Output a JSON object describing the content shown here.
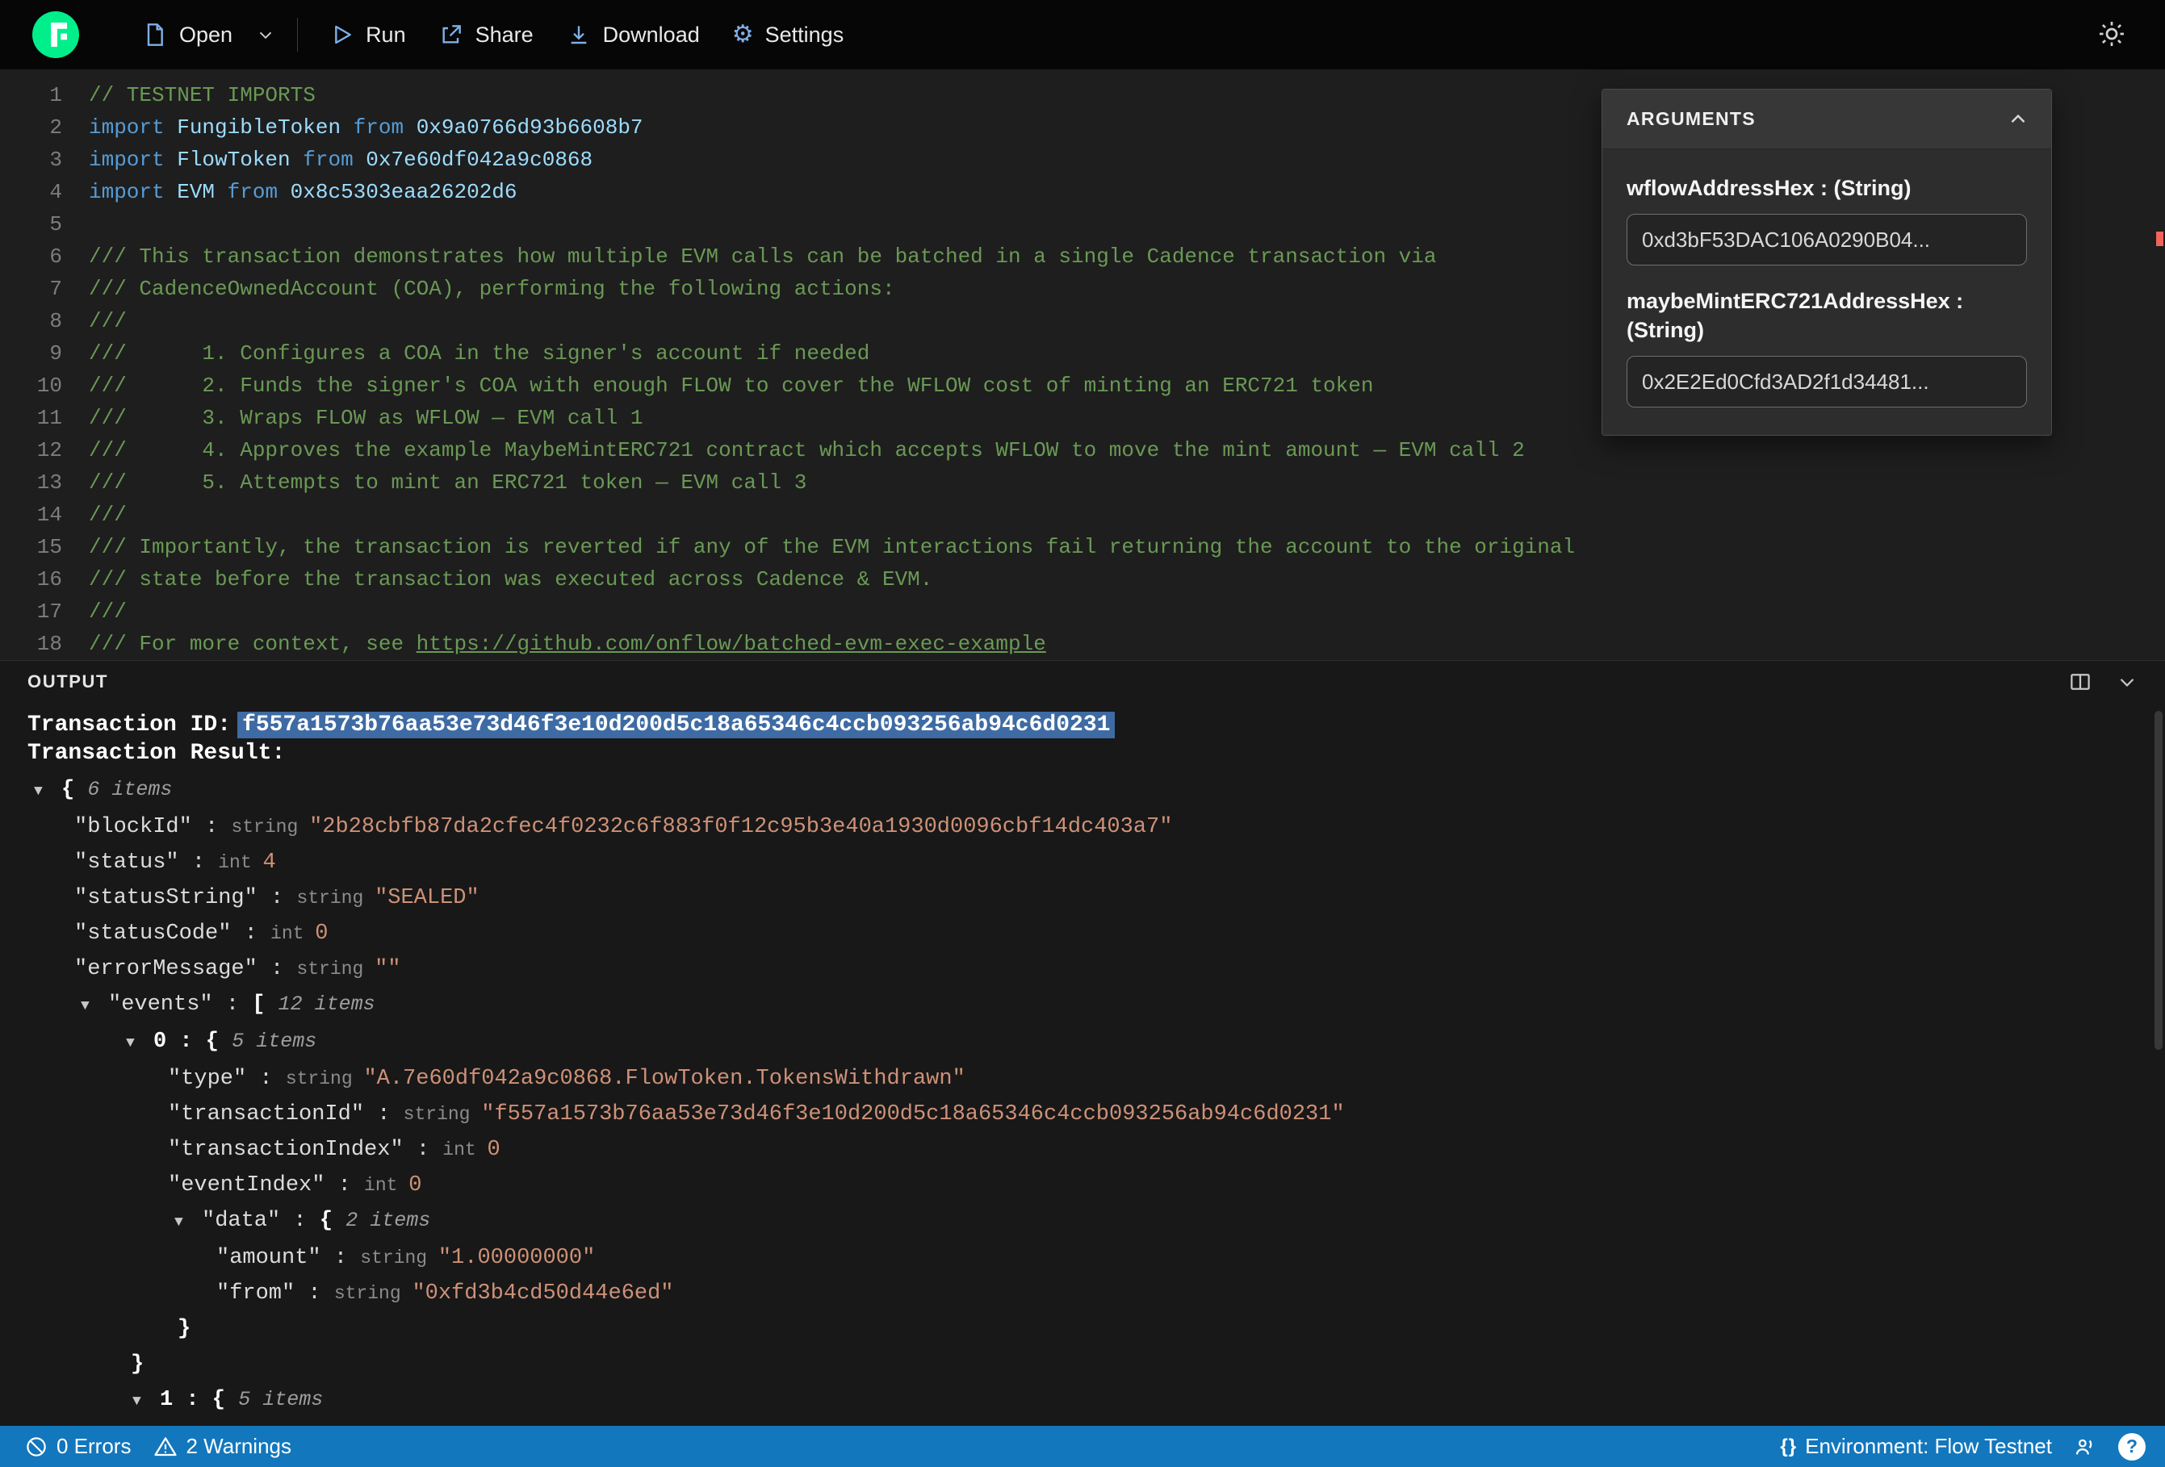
{
  "toolbar": {
    "open_label": "Open",
    "run_label": "Run",
    "share_label": "Share",
    "download_label": "Download",
    "settings_label": "Settings"
  },
  "editor": {
    "lines": [
      {
        "n": "1",
        "segs": [
          {
            "c": "comment",
            "t": "// TESTNET IMPORTS"
          }
        ]
      },
      {
        "n": "2",
        "segs": [
          {
            "c": "kw",
            "t": "import "
          },
          {
            "c": "ident",
            "t": "FungibleToken"
          },
          {
            "c": "kw",
            "t": " from "
          },
          {
            "c": "ident",
            "t": "0x9a0766d93b6608b7"
          }
        ]
      },
      {
        "n": "3",
        "segs": [
          {
            "c": "kw",
            "t": "import "
          },
          {
            "c": "ident",
            "t": "FlowToken"
          },
          {
            "c": "kw",
            "t": " from "
          },
          {
            "c": "ident",
            "t": "0x7e60df042a9c0868"
          }
        ]
      },
      {
        "n": "4",
        "segs": [
          {
            "c": "kw",
            "t": "import "
          },
          {
            "c": "ident",
            "t": "EVM"
          },
          {
            "c": "kw",
            "t": " from "
          },
          {
            "c": "ident",
            "t": "0x8c5303eaa26202d6"
          }
        ]
      },
      {
        "n": "5",
        "segs": []
      },
      {
        "n": "6",
        "segs": [
          {
            "c": "comment",
            "t": "/// This transaction demonstrates how multiple EVM calls can be batched in a single Cadence transaction via"
          }
        ]
      },
      {
        "n": "7",
        "segs": [
          {
            "c": "comment",
            "t": "/// CadenceOwnedAccount (COA), performing the following actions:"
          }
        ]
      },
      {
        "n": "8",
        "segs": [
          {
            "c": "comment",
            "t": "///"
          }
        ]
      },
      {
        "n": "9",
        "segs": [
          {
            "c": "comment",
            "t": "///      1. Configures a COA in the signer's account if needed"
          }
        ]
      },
      {
        "n": "10",
        "segs": [
          {
            "c": "comment",
            "t": "///      2. Funds the signer's COA with enough FLOW to cover the WFLOW cost of minting an ERC721 token"
          }
        ]
      },
      {
        "n": "11",
        "segs": [
          {
            "c": "comment",
            "t": "///      3. Wraps FLOW as WFLOW — EVM call 1"
          }
        ]
      },
      {
        "n": "12",
        "segs": [
          {
            "c": "comment",
            "t": "///      4. Approves the example MaybeMintERC721 contract which accepts WFLOW to move the mint amount — EVM call 2"
          }
        ]
      },
      {
        "n": "13",
        "segs": [
          {
            "c": "comment",
            "t": "///      5. Attempts to mint an ERC721 token — EVM call 3"
          }
        ]
      },
      {
        "n": "14",
        "segs": [
          {
            "c": "comment",
            "t": "///"
          }
        ]
      },
      {
        "n": "15",
        "segs": [
          {
            "c": "comment",
            "t": "/// Importantly, the transaction is reverted if any of the EVM interactions fail returning the account to the original"
          }
        ]
      },
      {
        "n": "16",
        "segs": [
          {
            "c": "comment",
            "t": "/// state before the transaction was executed across Cadence & EVM."
          }
        ]
      },
      {
        "n": "17",
        "segs": [
          {
            "c": "comment",
            "t": "///"
          }
        ]
      },
      {
        "n": "18",
        "segs": [
          {
            "c": "comment",
            "t": "/// For more context, see "
          },
          {
            "c": "link",
            "t": "https://github.com/onflow/batched-evm-exec-example"
          }
        ]
      }
    ]
  },
  "arguments_panel": {
    "title": "ARGUMENTS",
    "fields": [
      {
        "label": "wflowAddressHex : (String)",
        "value": "0xd3bF53DAC106A0290B04..."
      },
      {
        "label": "maybeMintERC721AddressHex : (String)",
        "value": "0x2E2Ed0Cfd3AD2f1d34481..."
      }
    ]
  },
  "output": {
    "title": "OUTPUT",
    "transaction_id_label": "Transaction ID:",
    "transaction_id": "f557a1573b76aa53e73d46f3e10d200d5c18a65346c4ccb093256ab94c6d0231",
    "transaction_result_label": "Transaction Result:",
    "arrow_glyph": "▼",
    "tree": [
      {
        "indent": 8,
        "arrow": true,
        "segs": [
          {
            "c": "brace",
            "t": "{ "
          },
          {
            "c": "items",
            "t": "6 items"
          }
        ]
      },
      {
        "indent": 58,
        "arrow": false,
        "segs": [
          {
            "c": "key",
            "t": "\"blockId\""
          },
          {
            "c": "punct",
            "t": " : "
          },
          {
            "c": "type",
            "t": "string "
          },
          {
            "c": "str",
            "t": "\"2b28cbfb87da2cfec4f0232c6f883f0f12c95b3e40a1930d0096cbf14dc403a7\""
          }
        ]
      },
      {
        "indent": 58,
        "arrow": false,
        "segs": [
          {
            "c": "key",
            "t": "\"status\""
          },
          {
            "c": "punct",
            "t": " : "
          },
          {
            "c": "type",
            "t": "int "
          },
          {
            "c": "num",
            "t": "4"
          }
        ]
      },
      {
        "indent": 58,
        "arrow": false,
        "segs": [
          {
            "c": "key",
            "t": "\"statusString\""
          },
          {
            "c": "punct",
            "t": " : "
          },
          {
            "c": "type",
            "t": "string "
          },
          {
            "c": "str",
            "t": "\"SEALED\""
          }
        ]
      },
      {
        "indent": 58,
        "arrow": false,
        "segs": [
          {
            "c": "key",
            "t": "\"statusCode\""
          },
          {
            "c": "punct",
            "t": " : "
          },
          {
            "c": "type",
            "t": "int "
          },
          {
            "c": "num",
            "t": "0"
          }
        ]
      },
      {
        "indent": 58,
        "arrow": false,
        "segs": [
          {
            "c": "key",
            "t": "\"errorMessage\""
          },
          {
            "c": "punct",
            "t": " : "
          },
          {
            "c": "type",
            "t": "string "
          },
          {
            "c": "str",
            "t": "\"\""
          }
        ]
      },
      {
        "indent": 66,
        "arrow": true,
        "segs": [
          {
            "c": "key",
            "t": "\"events\""
          },
          {
            "c": "punct",
            "t": " : "
          },
          {
            "c": "brace",
            "t": "[ "
          },
          {
            "c": "items",
            "t": "12 items"
          }
        ]
      },
      {
        "indent": 122,
        "arrow": true,
        "segs": [
          {
            "c": "brace",
            "t": "0 : { "
          },
          {
            "c": "items",
            "t": "5 items"
          }
        ]
      },
      {
        "indent": 174,
        "arrow": false,
        "segs": [
          {
            "c": "key",
            "t": "\"type\""
          },
          {
            "c": "punct",
            "t": " : "
          },
          {
            "c": "type",
            "t": "string "
          },
          {
            "c": "str",
            "t": "\"A.7e60df042a9c0868.FlowToken.TokensWithdrawn\""
          }
        ]
      },
      {
        "indent": 174,
        "arrow": false,
        "segs": [
          {
            "c": "key",
            "t": "\"transactionId\""
          },
          {
            "c": "punct",
            "t": " : "
          },
          {
            "c": "type",
            "t": "string "
          },
          {
            "c": "str",
            "t": "\"f557a1573b76aa53e73d46f3e10d200d5c18a65346c4ccb093256ab94c6d0231\""
          }
        ]
      },
      {
        "indent": 174,
        "arrow": false,
        "segs": [
          {
            "c": "key",
            "t": "\"transactionIndex\""
          },
          {
            "c": "punct",
            "t": " : "
          },
          {
            "c": "type",
            "t": "int "
          },
          {
            "c": "num",
            "t": "0"
          }
        ]
      },
      {
        "indent": 174,
        "arrow": false,
        "segs": [
          {
            "c": "key",
            "t": "\"eventIndex\""
          },
          {
            "c": "punct",
            "t": " : "
          },
          {
            "c": "type",
            "t": "int "
          },
          {
            "c": "num",
            "t": "0"
          }
        ]
      },
      {
        "indent": 182,
        "arrow": true,
        "segs": [
          {
            "c": "key",
            "t": "\"data\""
          },
          {
            "c": "punct",
            "t": " : "
          },
          {
            "c": "brace",
            "t": "{ "
          },
          {
            "c": "items",
            "t": "2 items"
          }
        ]
      },
      {
        "indent": 234,
        "arrow": false,
        "segs": [
          {
            "c": "key",
            "t": "\"amount\""
          },
          {
            "c": "punct",
            "t": " : "
          },
          {
            "c": "type",
            "t": "string "
          },
          {
            "c": "str",
            "t": "\"1.00000000\""
          }
        ]
      },
      {
        "indent": 234,
        "arrow": false,
        "segs": [
          {
            "c": "key",
            "t": "\"from\""
          },
          {
            "c": "punct",
            "t": " : "
          },
          {
            "c": "type",
            "t": "string "
          },
          {
            "c": "str",
            "t": "\"0xfd3b4cd50d44e6ed\""
          }
        ]
      },
      {
        "indent": 186,
        "arrow": false,
        "segs": [
          {
            "c": "brace",
            "t": "}"
          }
        ]
      },
      {
        "indent": 128,
        "arrow": false,
        "segs": [
          {
            "c": "brace",
            "t": "}"
          }
        ]
      },
      {
        "indent": 130,
        "arrow": true,
        "segs": [
          {
            "c": "brace",
            "t": "1 : { "
          },
          {
            "c": "items",
            "t": "5 items"
          }
        ]
      }
    ]
  },
  "statusbar": {
    "errors_label": "0 Errors",
    "warnings_label": "2 Warnings",
    "braces_icon": "{}",
    "environment_label": "Environment: Flow Testnet",
    "help_glyph": "?"
  },
  "colors": {
    "accent_green": "#00ef8b",
    "statusbar_blue": "#1277bd",
    "selection_blue": "#3e6ba3",
    "warning_mark_red": "#f0645a"
  }
}
